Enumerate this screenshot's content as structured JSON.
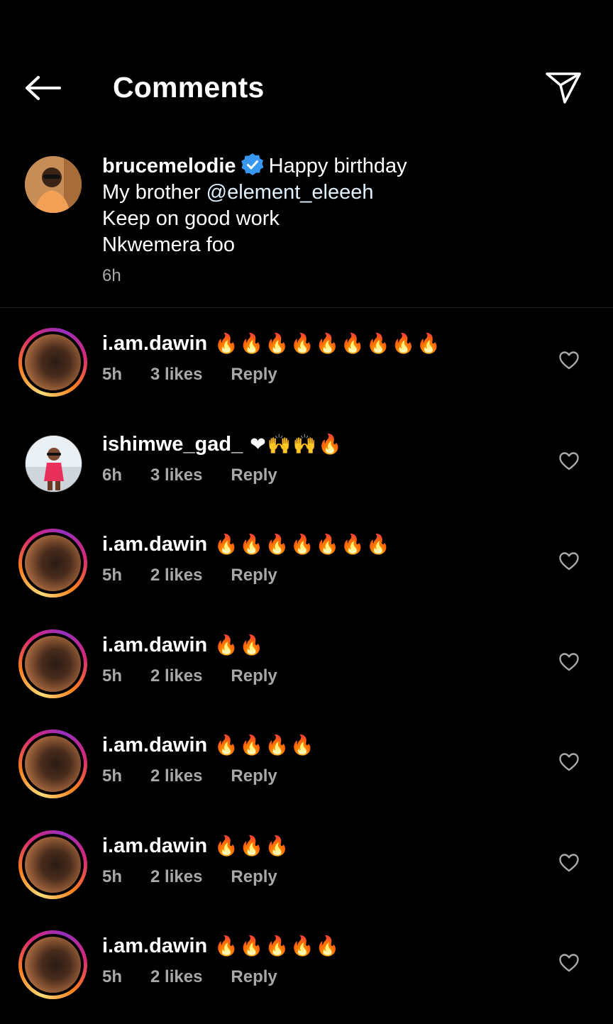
{
  "header": {
    "title": "Comments",
    "back_icon": "arrow-left-icon",
    "share_icon": "paper-plane-icon"
  },
  "caption": {
    "username": "brucemelodie",
    "verified": true,
    "line1": "Happy birthday",
    "line2_prefix": "My brother ",
    "mention": "@element_eleeeh",
    "line3": "Keep on good work",
    "line4": "Nkwemera foo",
    "time": "6h"
  },
  "comments": [
    {
      "username": "i.am.dawin",
      "text": "🔥🔥🔥🔥🔥🔥🔥🔥🔥",
      "time": "5h",
      "likes": "3 likes",
      "reply": "Reply",
      "story_ring": true
    },
    {
      "username": "ishimwe_gad_",
      "text": "❤🙌🙌🔥",
      "time": "6h",
      "likes": "3 likes",
      "reply": "Reply",
      "story_ring": false
    },
    {
      "username": "i.am.dawin",
      "text": "🔥🔥🔥🔥🔥🔥🔥",
      "time": "5h",
      "likes": "2 likes",
      "reply": "Reply",
      "story_ring": true
    },
    {
      "username": "i.am.dawin",
      "text": "🔥🔥",
      "time": "5h",
      "likes": "2 likes",
      "reply": "Reply",
      "story_ring": true
    },
    {
      "username": "i.am.dawin",
      "text": "🔥🔥🔥🔥",
      "time": "5h",
      "likes": "2 likes",
      "reply": "Reply",
      "story_ring": true
    },
    {
      "username": "i.am.dawin",
      "text": "🔥🔥🔥",
      "time": "5h",
      "likes": "2 likes",
      "reply": "Reply",
      "story_ring": true
    },
    {
      "username": "i.am.dawin",
      "text": "🔥🔥🔥🔥🔥",
      "time": "5h",
      "likes": "2 likes",
      "reply": "Reply",
      "story_ring": true
    }
  ],
  "colors": {
    "background": "#000000",
    "text": "#ffffff",
    "secondary_text": "#a8a8a8",
    "verified_blue": "#3897f0",
    "divider": "#262626"
  }
}
